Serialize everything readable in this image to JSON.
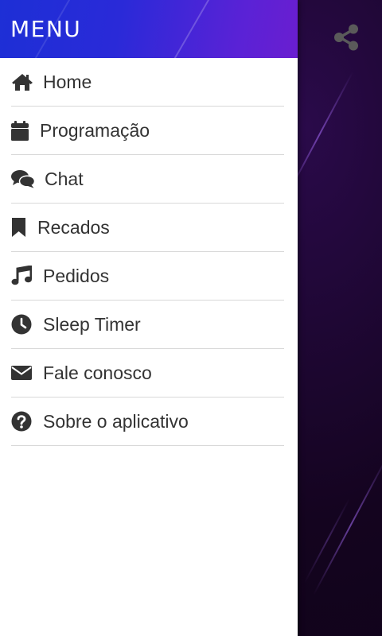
{
  "drawer": {
    "title": "MENU",
    "items": [
      {
        "label": "Home",
        "icon": "home-icon"
      },
      {
        "label": "Programação",
        "icon": "calendar-icon"
      },
      {
        "label": "Chat",
        "icon": "chat-icon"
      },
      {
        "label": "Recados",
        "icon": "bookmark-icon"
      },
      {
        "label": "Pedidos",
        "icon": "music-icon"
      },
      {
        "label": "Sleep Timer",
        "icon": "clock-icon"
      },
      {
        "label": "Fale conosco",
        "icon": "envelope-icon"
      },
      {
        "label": "Sobre o aplicativo",
        "icon": "question-icon"
      }
    ]
  },
  "toolbar": {
    "share_icon": "share-icon"
  },
  "colors": {
    "header_gradient_start": "#1d2fd6",
    "header_gradient_end": "#6a1ed0",
    "icon": "#333333",
    "text": "#333333",
    "divider": "#d8d8d8",
    "background": "#14041f"
  }
}
